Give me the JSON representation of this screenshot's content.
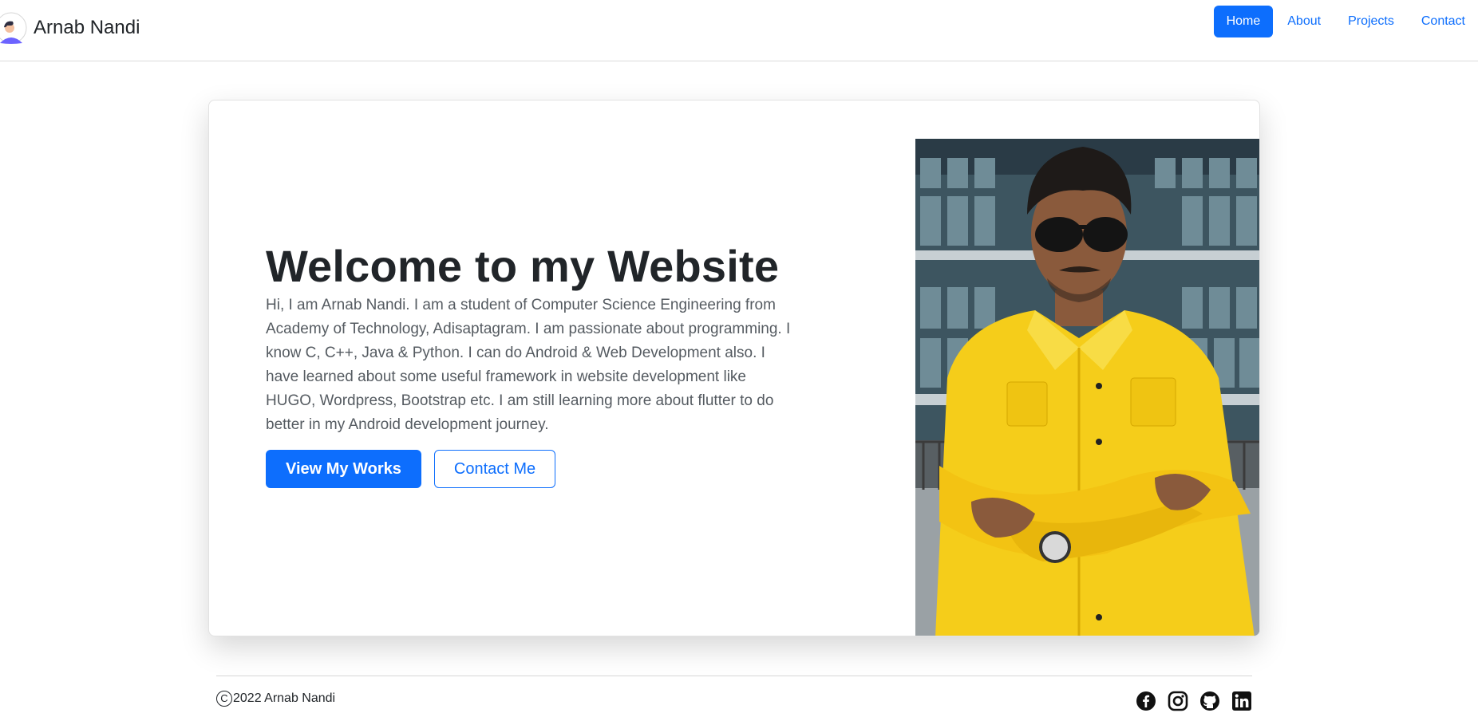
{
  "navbar": {
    "brand": "Arnab Nandi",
    "links": [
      "Home",
      "About",
      "Projects",
      "Contact"
    ],
    "active_index": 0
  },
  "hero": {
    "title": "Welcome to my Website",
    "description": "Hi, I am Arnab Nandi. I am a student of Computer Science Engineering from Academy of Technology, Adisaptagram. I am passionate about programming. I know C, C++, Java & Python. I can do Android & Web Development also. I have learned about some useful framework in website development like HUGO, Wordpress, Bootstrap etc. I am still learning more about flutter to do better in my Android development journey.",
    "primary_button": "View My Works",
    "secondary_button": "Contact Me"
  },
  "footer": {
    "copyright_symbol": "C",
    "copyright_text": "2022 Arnab Nandi",
    "socials": [
      "facebook-icon",
      "instagram-icon",
      "github-icon",
      "linkedin-icon"
    ]
  },
  "colors": {
    "primary": "#0d6efd",
    "text": "#212529",
    "muted_text": "#555b61",
    "photo_shirt": "#f5cd1a"
  }
}
